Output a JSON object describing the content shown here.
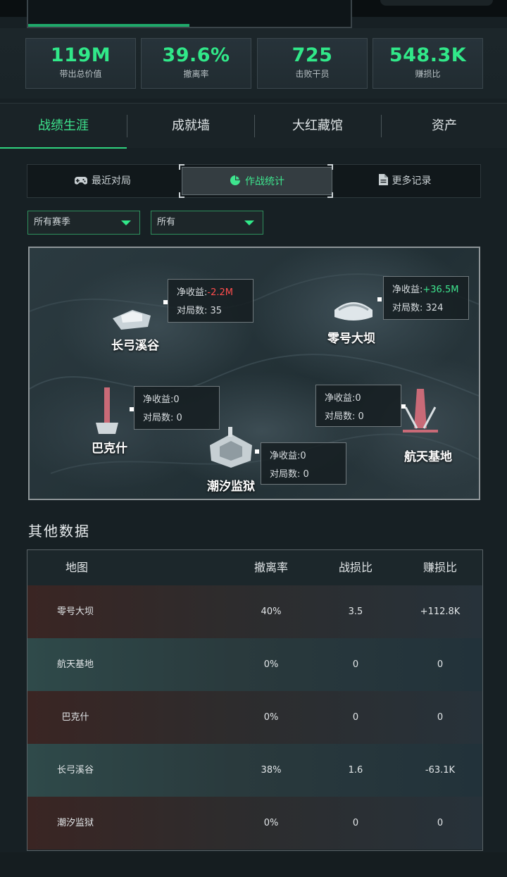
{
  "stats": [
    {
      "value": "119M",
      "label": "带出总价值"
    },
    {
      "value": "39.6%",
      "label": "撤离率"
    },
    {
      "value": "725",
      "label": "击败干员"
    },
    {
      "value": "548.3K",
      "label": "赚损比"
    }
  ],
  "tabs": [
    {
      "label": "战绩生涯",
      "active": true
    },
    {
      "label": "成就墙",
      "active": false
    },
    {
      "label": "大红藏馆",
      "active": false
    },
    {
      "label": "资产",
      "active": false
    }
  ],
  "segments": [
    {
      "label": "最近对局",
      "icon": "gamepad-icon",
      "active": false
    },
    {
      "label": "作战统计",
      "icon": "pie-chart-icon",
      "active": true
    },
    {
      "label": "更多记录",
      "icon": "document-icon",
      "active": false
    }
  ],
  "filters": {
    "season": "所有赛季",
    "mode": "所有"
  },
  "map": {
    "pois": [
      {
        "name": "长弓溪谷",
        "net_label": "净收益:",
        "net_value": "-2.2M",
        "net_tone": "negative",
        "count_label": "对局数:",
        "count_value": "35"
      },
      {
        "name": "零号大坝",
        "net_label": "净收益:",
        "net_value": "+36.5M",
        "net_tone": "positive",
        "count_label": "对局数:",
        "count_value": "324"
      },
      {
        "name": "巴克什",
        "net_label": "净收益:",
        "net_value": "0",
        "net_tone": "neutral",
        "count_label": "对局数:",
        "count_value": "0"
      },
      {
        "name": "航天基地",
        "net_label": "净收益:",
        "net_value": "0",
        "net_tone": "neutral",
        "count_label": "对局数:",
        "count_value": "0"
      },
      {
        "name": "潮汐监狱",
        "net_label": "净收益:",
        "net_value": "0",
        "net_tone": "neutral",
        "count_label": "对局数:",
        "count_value": "0"
      }
    ]
  },
  "other": {
    "title": "其他数据",
    "headers": [
      "地图",
      "撤离率",
      "战损比",
      "赚损比"
    ],
    "rows": [
      [
        "零号大坝",
        "40%",
        "3.5",
        "+112.8K"
      ],
      [
        "航天基地",
        "0%",
        "0",
        "0"
      ],
      [
        "巴克什",
        "0%",
        "0",
        "0"
      ],
      [
        "长弓溪谷",
        "38%",
        "1.6",
        "-63.1K"
      ],
      [
        "潮汐监狱",
        "0%",
        "0",
        "0"
      ]
    ]
  },
  "colors": {
    "accent": "#31e889",
    "negative": "#ff4d4d",
    "background": "#172024"
  }
}
